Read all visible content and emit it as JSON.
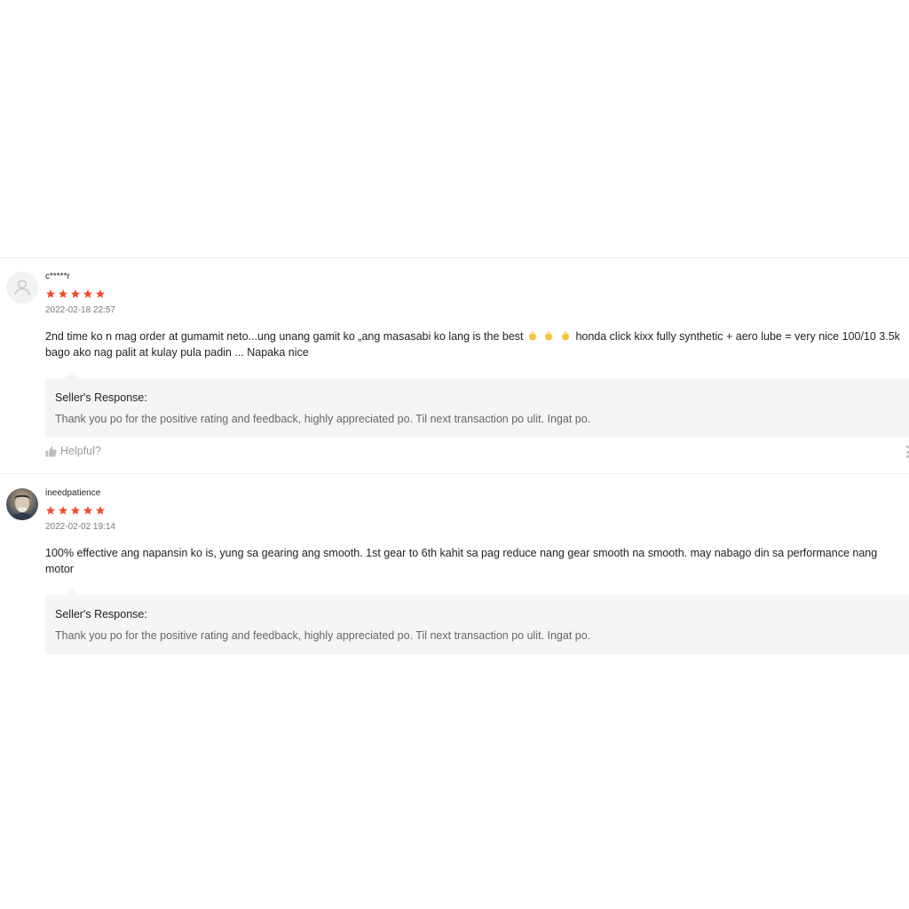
{
  "reviews": [
    {
      "username": "c*****r",
      "rating": 5,
      "date": "2022-02-18 22:57",
      "comment_before": "2nd time ko n mag order at gumamit neto...ung unang gamit ko „ang masasabi ko lang is the best",
      "emojis": [
        "ok-hand-emoji",
        "ok-hand-emoji",
        "ok-hand-emoji"
      ],
      "comment_after": "honda click kixx fully synthetic + aero lube = very nice 100/10 3.5k bago ako nag palit at kulay pula padin ... Napaka nice",
      "seller_response_title": "Seller's Response:",
      "seller_response_text": "Thank you po for the positive rating and feedback, highly appreciated po. Til next transaction po ulit. Ingat po.",
      "helpful_label": "Helpful?"
    },
    {
      "username": "ineedpatience",
      "rating": 5,
      "date": "2022-02-02 19:14",
      "comment": "100% effective ang napansin ko is, yung sa gearing ang smooth. 1st gear to 6th kahit sa pag reduce nang gear smooth na smooth. may nabago din sa performance nang motor",
      "seller_response_title": "Seller's Response:",
      "seller_response_text": "Thank you po for the positive rating and feedback, highly appreciated po. Til next transaction po ulit. Ingat po."
    }
  ],
  "colors": {
    "star": "#ee4d2d",
    "response_bg": "#f5f5f5",
    "muted_text": "#666666"
  }
}
